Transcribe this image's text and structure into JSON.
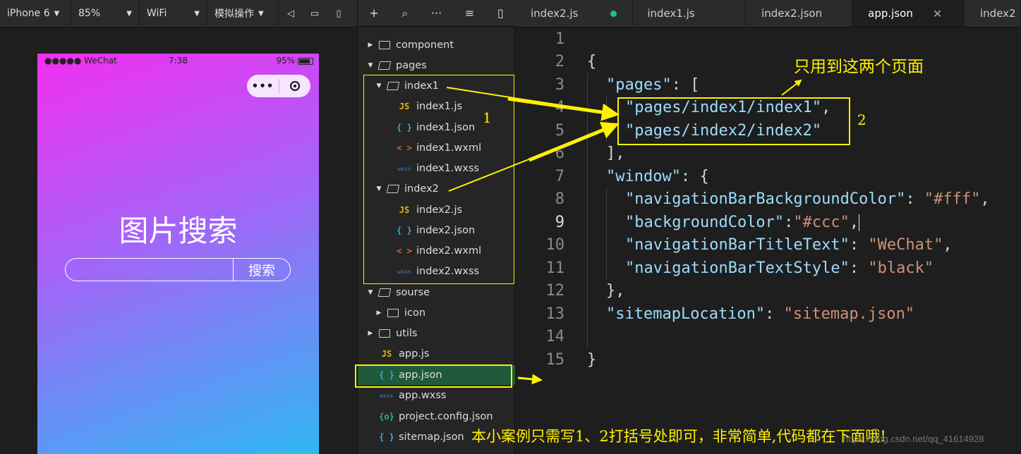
{
  "sim_toolbar": {
    "device": "iPhone 6",
    "zoom": "85%",
    "network": "WiFi",
    "operation": "模拟操作"
  },
  "tabs": [
    {
      "label": "index2.js"
    },
    {
      "label": "index1.js"
    },
    {
      "label": "index2.json"
    },
    {
      "label": "app.json"
    },
    {
      "label": "index2"
    }
  ],
  "phone": {
    "carrier": "●●●●● WeChat",
    "time": "7:38",
    "battery": "95%",
    "title": "图片搜索",
    "search_button": "搜索",
    "capsule_dots": "•••"
  },
  "tree": [
    {
      "label": "component"
    },
    {
      "label": "pages"
    },
    {
      "label": "index1"
    },
    {
      "label": "index1.js",
      "badge": "JS"
    },
    {
      "label": "index1.json",
      "badge": "{ }"
    },
    {
      "label": "index1.wxml",
      "badge": "< >"
    },
    {
      "label": "index1.wxss",
      "badge": "wxss"
    },
    {
      "label": "index2"
    },
    {
      "label": "index2.js",
      "badge": "JS"
    },
    {
      "label": "index2.json",
      "badge": "{ }"
    },
    {
      "label": "index2.wxml",
      "badge": "< >"
    },
    {
      "label": "index2.wxss",
      "badge": "wxss"
    },
    {
      "label": "sourse"
    },
    {
      "label": "icon"
    },
    {
      "label": "utils"
    },
    {
      "label": "app.js",
      "badge": "JS"
    },
    {
      "label": "app.json",
      "badge": "{ }"
    },
    {
      "label": "app.wxss",
      "badge": "wxss"
    },
    {
      "label": "project.config.json",
      "badge": "{o}"
    },
    {
      "label": "sitemap.json",
      "badge": "{ }"
    }
  ],
  "editor": {
    "line_numbers": [
      "1",
      "2",
      "3",
      "4",
      "5",
      "6",
      "7",
      "8",
      "9",
      "10",
      "11",
      "12",
      "13",
      "14",
      "15"
    ],
    "tokens": {
      "l2": "{",
      "l3k": "\"pages\"",
      "l3p": ": [",
      "l4s": "\"pages/index1/index1\"",
      "l4p": ",",
      "l5s": "\"pages/index2/index2\"",
      "l6": "],",
      "l7k": "\"window\"",
      "l7p": ": {",
      "l8k": "\"navigationBarBackgroundColor\"",
      "l8p": ": ",
      "l8v": "\"#fff\"",
      "l8e": ",",
      "l9k": "\"backgroundColor\"",
      "l9p": ":",
      "l9v": "\"#ccc\"",
      "l9e": ",",
      "l10k": "\"navigationBarTitleText\"",
      "l10p": ": ",
      "l10v": "\"WeChat\"",
      "l10e": ",",
      "l11k": "\"navigationBarTextStyle\"",
      "l11p": ": ",
      "l11v": "\"black\"",
      "l12": "},",
      "l13k": "\"sitemapLocation\"",
      "l13p": ": ",
      "l13v": "\"sitemap.json\"",
      "l15": "}"
    }
  },
  "annotations": {
    "label1": "1",
    "label2": "2",
    "top_note": "只用到这两个页面",
    "bottom_note": "本小案例只需写1、2打括号处即可，非常简单,代码都在下面哦!",
    "color": "#fff200"
  },
  "watermark": "https://blog.csdn.net/qq_41614928"
}
